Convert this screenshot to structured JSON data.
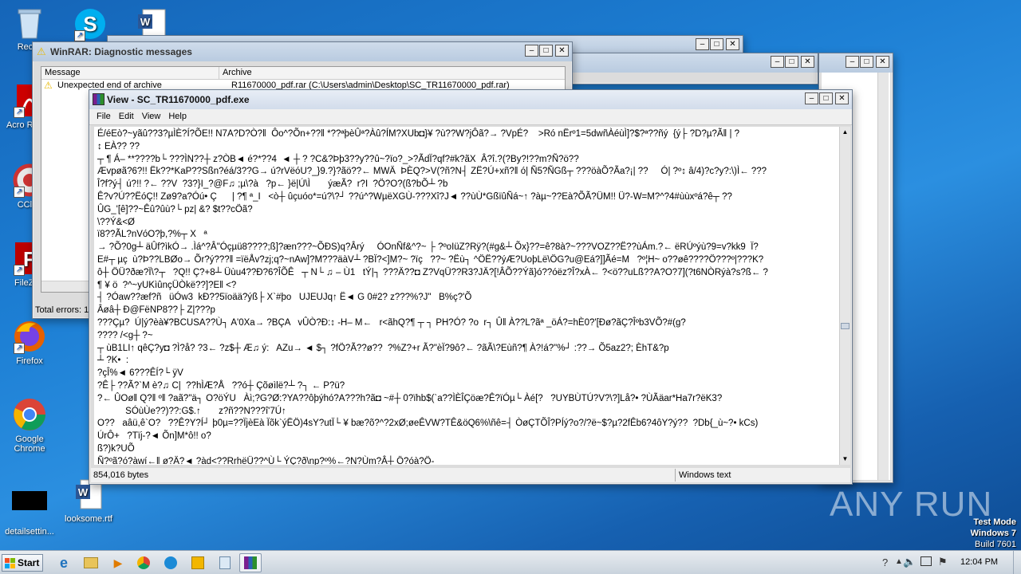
{
  "desktop": {
    "icons": [
      {
        "label": "Recycle Bin",
        "short": "Recyc"
      },
      {
        "label": "Acrobat Reader",
        "short": "Acro Reade"
      },
      {
        "label": "CCleaner",
        "short": "CClea"
      },
      {
        "label": "FileZilla",
        "short": "FileZilla"
      },
      {
        "label": "Firefox"
      },
      {
        "label": "Google Chrome"
      },
      {
        "label": "detailsettin..."
      },
      {
        "label": "looksome.rtf"
      }
    ]
  },
  "winrar_diag": {
    "title": "WinRAR: Diagnostic messages",
    "col_message": "Message",
    "col_archive": "Archive",
    "row_message": "Unexpected end of archive",
    "row_archive": "R11670000_pdf.rar (C:\\Users\\admin\\Desktop\\SC_TR11670000_pdf.rar)",
    "total_errors": "Total errors: 1"
  },
  "viewer": {
    "title": "View - SC_TR11670000_pdf.exe",
    "menu": [
      "File",
      "Edit",
      "View",
      "Help"
    ],
    "status_size": "854,016 bytes",
    "status_encoding": "Windows text",
    "lines": [
      "É/éEò?~yãû??3?µÌÈ?Í?ÕE!! N7A?D?Ò?‖  Ôo^?Õn+??‖ *??ªþèÛª?Àû?ÍM?XUb◘}¥ ?ù??W?jÔã?→ ?VpÉ?    >Ró nËrº1=5dwñÀéùÌ]?$?ª??ñý  {ý├ ?D?µ?Ã‖ | ?",
      "↕ EÀ?? ??",
      "┬ ¶ Á– **????b└ ???ÌN??┼ z?ÒB◄ é?*??4  ◄ ┼ ? ?C&?Þþ3??y??û~?ïo?_>?ÃdÏ?qf?#k?ãX  Â?î.?(?By?!??m?Ñ?ö??",
      "Ævpøã?6?!! Ëk??*KaP??Sßn?éá/3??G→ ú?rVëóU?_}9.?}?ãö??← MWÄ  ÞÈQ?>V(?ñ?N┤ ZË?Ú+xñ?‖ ó| Ñ5?ÑGß┬ ???öàÕ?Ãa?¡| ??     Ó| ?º↕ â/4)?c?y?:\\)Ì← ???",
      "Î?f?ý┤ ú?!! ?← ??V  ?3?}I_?@F♫ ;µ\\?à   ?p← }ë|Ú\\Ì       ýæÃ?  r?I  ?Ö?O?(ß?bÕ┴ ?b",
      "Ê?v?Ú??ËóÇ!! Zø9?a?Óú• Ç      | ?¶ ª_I   <ò┼ ûçuóo*=ú?\\?┘ ??ú^?WµëXGÙ-???Xî?J◄ ??ùÙ*GßïûÑá~↑ ?àµ~??Eà?ÕÃ?ÜM!! Ü?-W=M?^?4#ùùxºá?ê┬ ??",
      "ÛG_'[ê]??~Êû?ûù?└ pz| &? $t??cÖã?",
      "\\??Ý&<Ø",
      "ï8??ÃL?nVóO?þ,?%┬ X   ª",
      "→ ?Õ?0g┴ äÛf?ìkÓ→ .Ìá^?Â\"Óçµü8????;ß]?æn???~ÕÐS)q?Ârý     ÓOnÑf&^?~ ├ ?ºoIüZ?Rÿ?(#g&┴ Õx}??=ê?8à?~???VOZ??Ë??ùÁm.?← ëRÚºýù?9=v?kk9  Ï?",
      "E#┬ µç  ù?Þ??LBØo→ Õr?ý???‖ =ïëÅv?zj;q?~nAw]?M???äàV┴ ?BÏ?<]M?~ ?ïç   ??~ ?Ëù┐ ^ÖË??ýÆ?UoþLë\\ÖG?u@Eá?]]Ãé=M   ?º¦H~ o??øê????Ö???º|???K?",
      "ô┼ ÖÜ?ðæ?Ï\\?┬   ?Q!! Ç?+8┴ Üùu4??Ð?6?ÎÕÊ   ┬ N└ ♫ – Ù1   tÝ|┐ ???Ä??◘ Z?VqÜ??R3?JÄ?[!ÂÕ??Ýã}ó??óëz?Î?xÀ← ?<ö??uLß??A?O?7](?t6NÒRýà?s?ß← ?",
      "¶ ¥ ö  ?^~yUKìûnçÜÒkë??]?E‖ <?",
      "┤ ?Óaw??æf?ñ   üÓw3  kÐ??5ïoää?ýß├ X`#þo   UJEUJq↑ Ë◄ G 0#2? z???%?J\"   B%ç?'Õ",
      "Âøâ┼ Ð@FëNP8??├ Z|???p",
      "???Çµ?  Ú|ý?èà¥?BCUSA??Ù┐ A'0Xa→ ?BÇA   vÛÒ?Ð:↕ -H– M←   r<ãhQ?¶ ┬ ┐ PH?Ó? ?o  r┐ Û‖ À??L?ãª _öÁ?=hÈ0?'[Ðø?ãÇ?Îºb3VÕ?#(g?",
      "???? /<g┼ ?~",
      "┬ ùB1LI↑ qêÇ?y◘ ?Ì?å? ?3← ?z$┼ Æ♫ ý:   AZu→ ◄ $┐ ?fÖ?Ã??ø??  ?%Z?+r Ã?\"èÏ?9ô?← ?ãÃ\\?Eùñ?¶ À?!á?\"%┘ :??→ Õ5az2?; ÈhT&?p",
      "┴ ?K•  :",
      "?çÎ%◄ 6???ÊÍ?└ ÿV",
      "?Ê├ ??Ã?`M è?♫ C|  ??hÌÆ?Å   ??ó┼ Çõøìlë?┴ ?┐ ← P?ü?",
      "?← ÛOø‖ Q?‖ º‖ ?aã?\"ä┐ O?öÝU   Àì;?G?Ø:?YA??ôþýhó?A???h?ã◘ ~#┼ 0?ïhb$(`a??ÌÈÎÇöæ?Ê?ïÓµ└ Àé[?   ?UYBÙTÚ?V?\\?]Lå?• ?ÙÃäar*Ha7r?ëK3?",
      "           SÓùÙe??)??:G$.↑       z?ñ??N???î'7Ú↑",
      "O??   aâü,ê`O?   ??Ê?Y?Í┘ þ0µ=??ÏjèEà Ïõk`ýËÖ)4sY?utÏ└ ¥ bæ?õ?^?2xØ;øeÊVW?TÊ&öQ6%\\ñê=┤ ÒøÇTÕÎ?PÍý?o?/?ë~$?µ?2fÊb6?4ôY?ý??  ?Db{_ù~?• kCs)",
      "ÚrÔ+   ?Tïj-?◄ Õn]M*ô!! o?",
      "ß?)k?UÕ",
      "Ñ?ºã?ó?àwí←‖ ø?Ä?◄ ?àd<??RrhëÜ??^Ù└ ÝÇ?ð\\np?º%←?N?Ùm?Â┼ Ö?óà?Ö-"
    ]
  },
  "watermark": {
    "brand": "ANY RUN",
    "test_mode": "Test Mode",
    "os": "Windows 7",
    "build": "Build 7601"
  },
  "taskbar": {
    "start": "Start",
    "time": "12:04 PM"
  }
}
